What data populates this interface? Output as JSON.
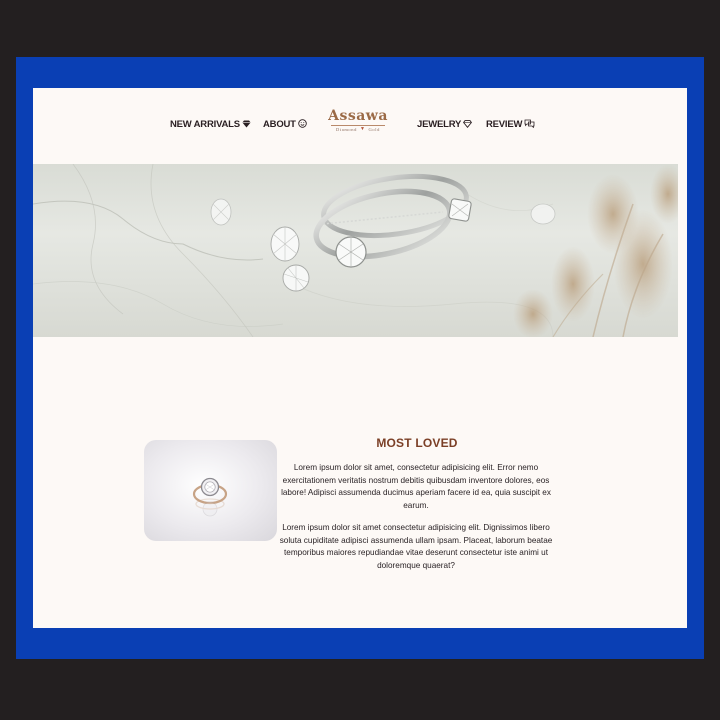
{
  "nav": {
    "new_arrivals": "NEW ARRIVALS",
    "new_arrivals_icon": "diamond-icon",
    "about": "ABOUT",
    "about_icon": "smiley-icon",
    "jewelry": "JEWELRY",
    "jewelry_icon": "diamond-outline-icon",
    "review": "REVIEW",
    "review_icon": "chat-bubbles-icon"
  },
  "logo": {
    "wordmark": "Assawa",
    "sub_left": "Diamond",
    "sub_right": "Gold"
  },
  "hero": {
    "image": "rings-on-marble-photo"
  },
  "most_loved": {
    "title": "MOST LOVED",
    "paragraph_1": "Lorem ipsum dolor sit amet, consectetur adipisicing elit. Error nemo exercitationem veritatis nostrum debitis quibusdam inventore dolores, eos labore! Adipisci assumenda ducimus aperiam facere id ea, quia suscipit ex earum.",
    "paragraph_2": "Lorem ipsum dolor sit amet consectetur adipisicing elit. Dignissimos libero soluta cupiditate adipisci assumenda ullam ipsam. Placeat, laborum beatae temporibus maiores repudiandae vitae deserunt consectetur iste animi ut doloremque quaerat?"
  },
  "colors": {
    "frame_blue": "#0a3fb4",
    "outer_dark": "#231f20",
    "page_bg": "#fdf9f6",
    "accent_brown": "#7b3f26"
  }
}
